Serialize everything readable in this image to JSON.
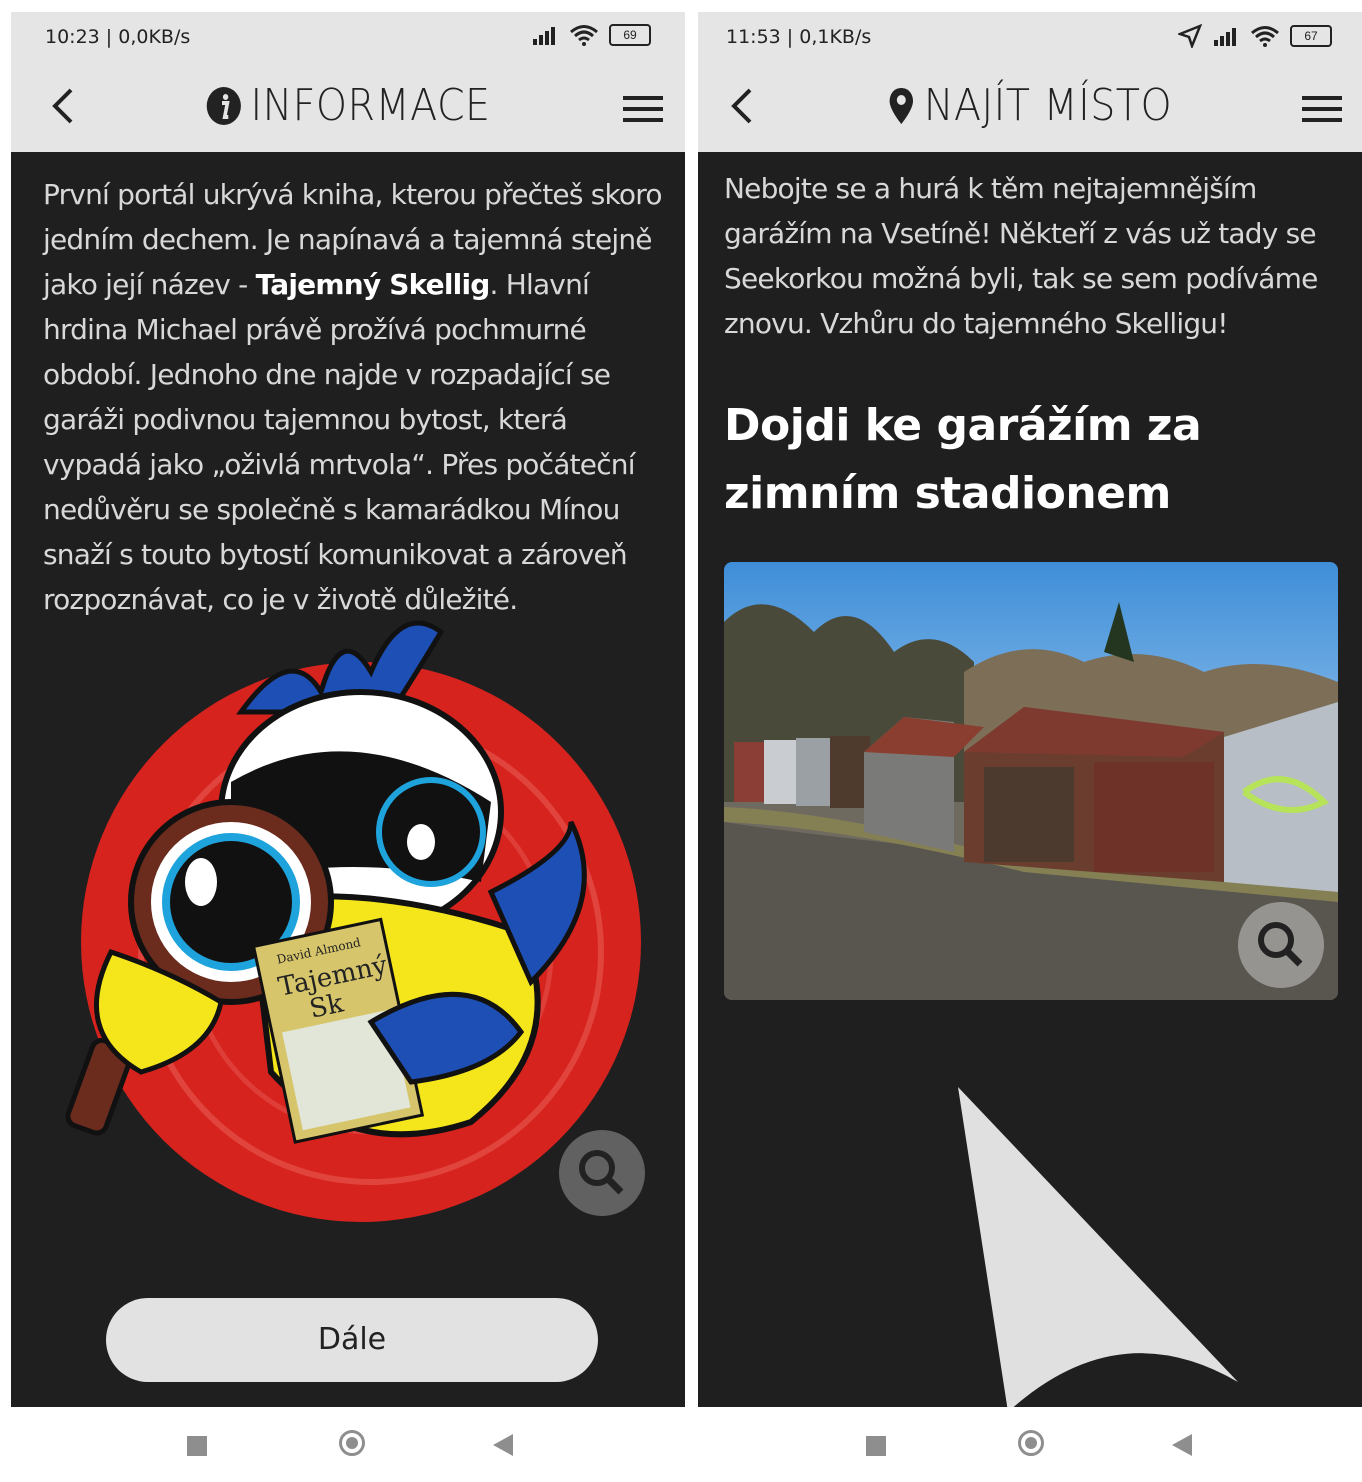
{
  "left": {
    "status": {
      "time": "10:23 | 0,0KB/s",
      "battery": "69"
    },
    "header": {
      "title": "INFORMACE",
      "title_icon": "info-icon"
    },
    "text": {
      "p1": "První portál ukrývá kniha, kterou přečteš skoro jedním dechem. Je napínavá a tajemná stejně jako její název - ",
      "bold": "Tajemný Skellig",
      "p2": ". Hlavní hrdina Michael právě prožívá pochmurné období. Jednoho dne najde v rozpadající se garáži podivnou tajemnou bytost, která vypadá jako „oživlá mrtvola“. Přes počáteční nedůvěru se společně s kamarádkou Mínou snaží s touto bytostí komunikovat a zároveň rozpoznávat, co je v životě důležité."
    },
    "book": {
      "author": "David Almond",
      "title_line1": "Tajemný",
      "title_line2": "Sk"
    },
    "button": {
      "label": "Dále"
    }
  },
  "right": {
    "status": {
      "time": "11:53 | 0,1KB/s",
      "battery": "67"
    },
    "header": {
      "title": "NAJÍT MÍSTO",
      "title_icon": "location-pin-icon"
    },
    "intro": "Nebojte se a hurá k těm nejtajemnějším garážím na Vsetíně! Někteří z vás už tady se Seekorkou možná byli, tak se sem podíváme znovu. Vzhůru do tajemného Skelligu!",
    "heading": "Dojdi ke garážím za zimním stadionem"
  },
  "colors": {
    "background": "#1f1f20",
    "appbar": "#e5e5e5",
    "accent_red": "#d6231e",
    "accent_blue": "#1e4fb4",
    "accent_yellow": "#f4e61a"
  }
}
